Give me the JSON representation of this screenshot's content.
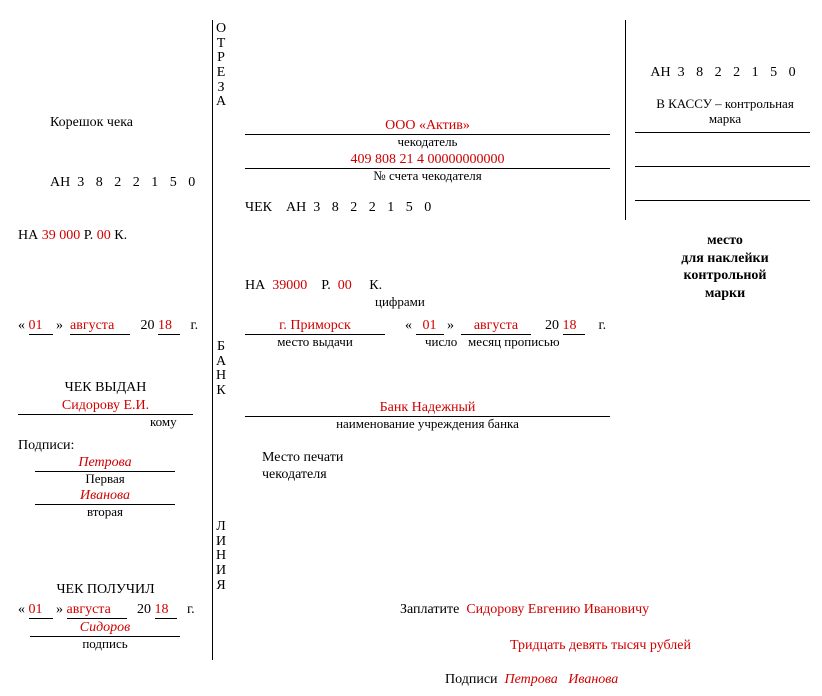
{
  "vlabels": {
    "otreza": "ОТРЕЗА",
    "bank": "БАНК",
    "linia": "ЛИНИЯ"
  },
  "stub": {
    "title": "Корешок чека",
    "serial_prefix": "АН",
    "serial_number": "3 8 2 2 1 5 0",
    "amount_prefix": "НА",
    "amount_rub": "39 000",
    "cur_r": "Р.",
    "amount_kop": "00",
    "cur_k": "К.",
    "date_open": "«",
    "date_day": "01",
    "date_close": "»",
    "date_month": "августа",
    "date_year_prefix": "20",
    "date_year": "18",
    "date_year_suffix": "г.",
    "issued_title": "ЧЕК ВЫДАН",
    "issued_to": "Сидорову Е.И.",
    "issued_caption": "кому",
    "sign_label": "Подписи:",
    "sig1_value": "Петрова",
    "sig1_caption": "Первая",
    "sig2_value": "Иванова",
    "sig2_caption": "вторая",
    "received_title": "ЧЕК ПОЛУЧИЛ",
    "recv_day": "01",
    "recv_month": "августа",
    "recv_year": "18",
    "recv_sign": "Сидоров",
    "recv_sign_caption": "подпись"
  },
  "main": {
    "drawer_name": "ООО «Актив»",
    "drawer_caption": "чекодатель",
    "account_number": "409 808 21 4 00000000000",
    "account_caption": "№ счета чекодателя",
    "cheque_label": "ЧЕК",
    "serial_prefix": "АН",
    "serial_number": "3 8 2 2 1 5 0",
    "amount_prefix": "НА",
    "amount_rub": "39000",
    "cur_r": "Р.",
    "amount_kop": "00",
    "cur_k": "К.",
    "amount_caption": "цифрами",
    "place": "г. Приморск",
    "place_caption": "место выдачи",
    "date_open": "«",
    "date_day": "01",
    "date_close": "»",
    "date_month": "августа",
    "date_year_prefix": "20",
    "date_year": "18",
    "date_year_suffix": "г.",
    "date_num_caption": "число",
    "date_month_caption": "месяц прописью",
    "bank_name": "Банк Надежный",
    "bank_caption": "наименование учреждения банка",
    "stamp_line1": "Место печати",
    "stamp_line2": "чекодателя",
    "pay_label": "Заплатите",
    "payee_full": "Сидорову Евгению Ивановичу",
    "amount_words": "Тридцать девять тысяч рублей",
    "bottom_sign_label": "Подписи",
    "bottom_sign1": "Петрова",
    "bottom_sign2": "Иванова"
  },
  "kassa": {
    "serial_prefix": "АН",
    "serial_number": "3 8 2 2 1 5 0",
    "line1": "В КАССУ – контрольная",
    "line2": "марка",
    "sticker_l1": "место",
    "sticker_l2": "для наклейки",
    "sticker_l3": "контрольной",
    "sticker_l4": "марки"
  }
}
